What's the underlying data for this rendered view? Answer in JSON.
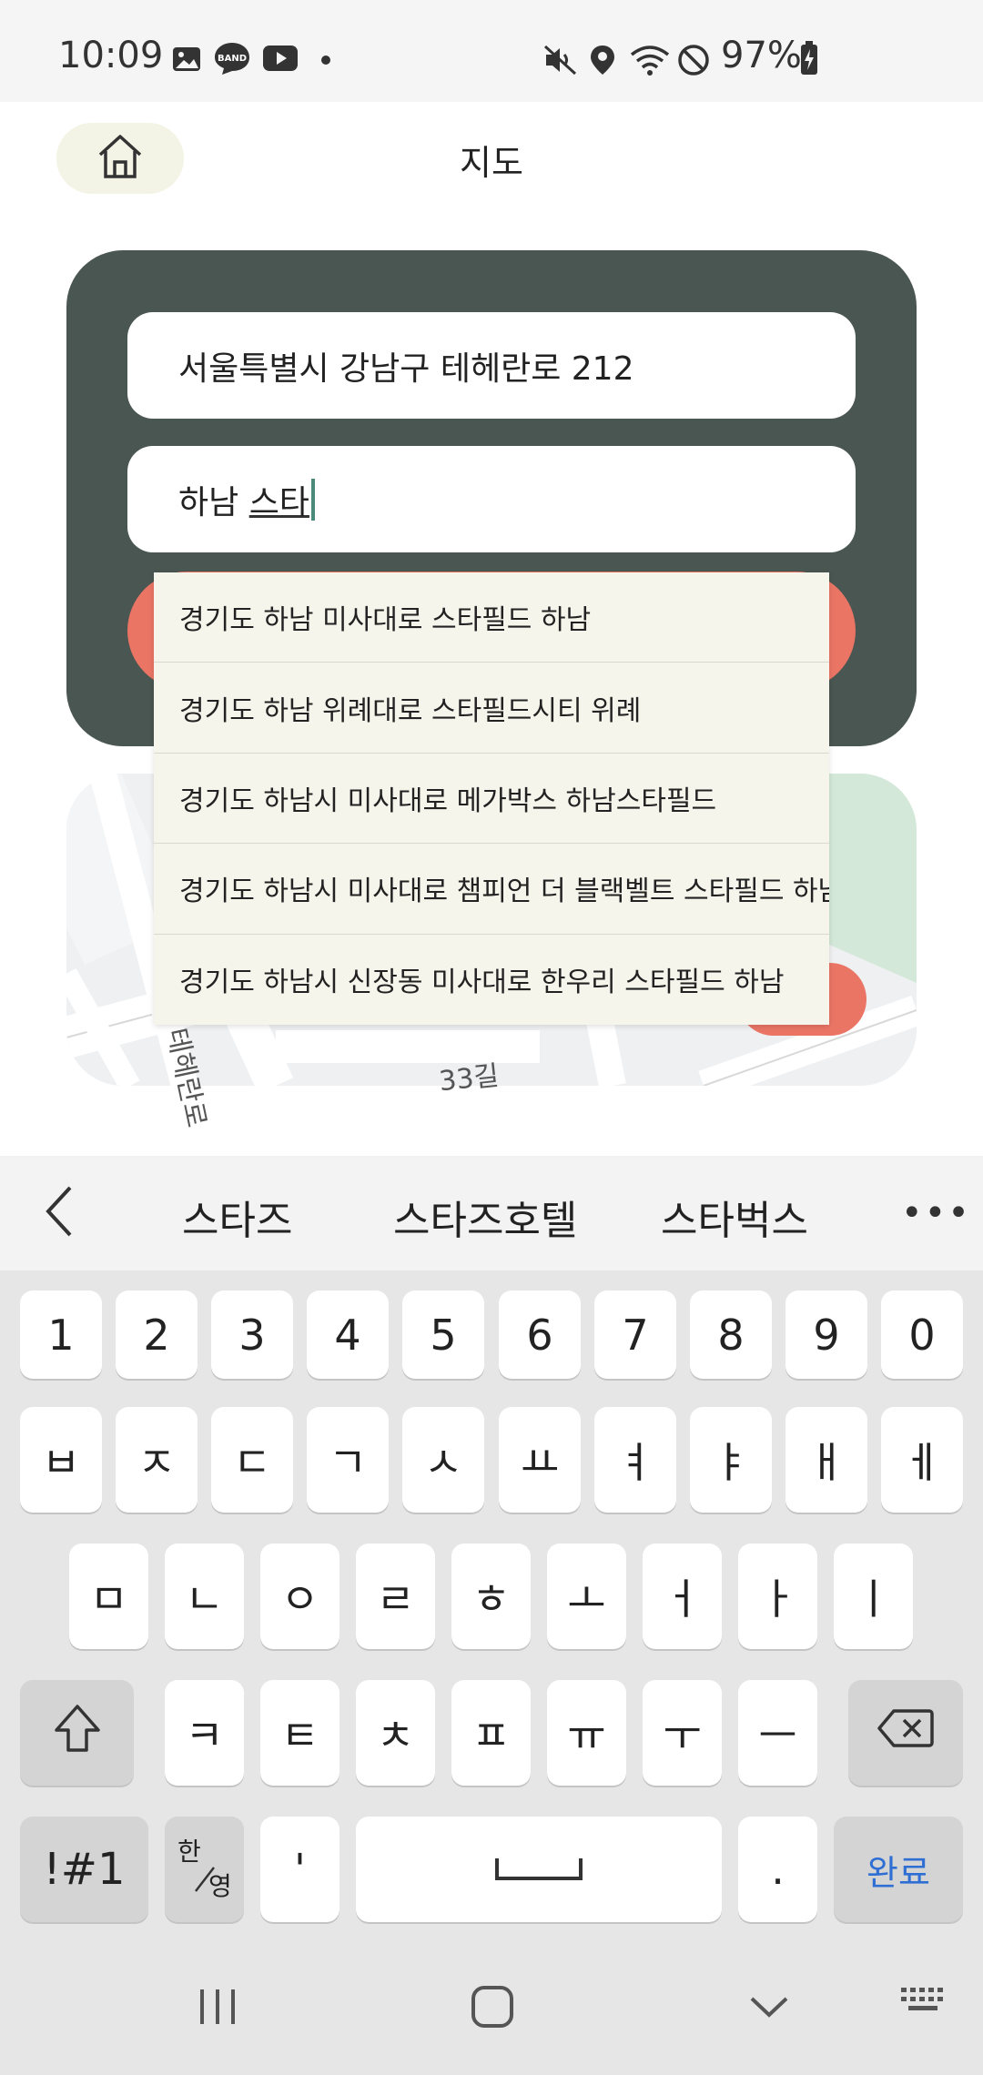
{
  "status_bar": {
    "time": "10:09",
    "battery": "97%",
    "notification_icons": [
      "gallery-icon",
      "band-icon",
      "youtube-icon",
      "dot-icon"
    ],
    "system_icons": [
      "mute-icon",
      "location-icon",
      "wifi-icon",
      "dnd-icon",
      "battery-charging-icon"
    ]
  },
  "header": {
    "title": "지도",
    "home_icon": "home-icon"
  },
  "route_form": {
    "origin_value": "서울특별시 강남구 테헤란로 212",
    "destination_committed": "하남 ",
    "destination_composing": "스타"
  },
  "suggestions": [
    "경기도 하남 미사대로 스타필드 하남",
    "경기도 하남 위례대로 스타필드시티 위례",
    "경기도 하남시 미사대로 메가박스 하남스타필드",
    "경기도 하남시 미사대로 챔피언 더 블랙벨트 스타필드 하남점",
    "경기도 하남시 신장동 미사대로 한우리 스타필드 하남"
  ],
  "map": {
    "labels": [
      "테헤란로",
      "33길"
    ]
  },
  "keyboard": {
    "predictions": [
      "스타즈",
      "스타즈호텔",
      "스타벅스"
    ],
    "more": "•••",
    "number_row": [
      "1",
      "2",
      "3",
      "4",
      "5",
      "6",
      "7",
      "8",
      "9",
      "0"
    ],
    "row1": [
      "ㅂ",
      "ㅈ",
      "ㄷ",
      "ㄱ",
      "ㅅ",
      "ㅛ",
      "ㅕ",
      "ㅑ",
      "ㅐ",
      "ㅔ"
    ],
    "row2": [
      "ㅁ",
      "ㄴ",
      "ㅇ",
      "ㄹ",
      "ㅎ",
      "ㅗ",
      "ㅓ",
      "ㅏ",
      "ㅣ"
    ],
    "row3": [
      "ㅋ",
      "ㅌ",
      "ㅊ",
      "ㅍ",
      "ㅠ",
      "ㅜ",
      "ㅡ"
    ],
    "symbols": "!#1",
    "lang_top": "한",
    "lang_bottom": "영",
    "apostrophe": "'",
    "period": ".",
    "done": "완료"
  },
  "colors": {
    "panel": "#4a5651",
    "accent": "#ea7565",
    "suggestion_bg": "#f6f5ec",
    "done_text": "#2f6fd3"
  }
}
